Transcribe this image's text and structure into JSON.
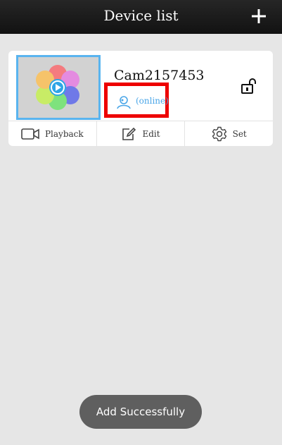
{
  "header": {
    "title": "Device list",
    "add_icon": "plus-icon"
  },
  "device": {
    "name": "Cam2157453",
    "status": "(online)",
    "status_icon": "user-icon",
    "lock_icon": "unlock-icon",
    "thumbnail_icon": "photo-flower-play-icon"
  },
  "actions": [
    {
      "label": "Playback",
      "icon": "video-camera-icon"
    },
    {
      "label": "Edit",
      "icon": "edit-icon"
    },
    {
      "label": "Set",
      "icon": "gear-icon"
    }
  ],
  "toast": {
    "message": "Add Successfully"
  },
  "colors": {
    "header_bg": "#1b1b1b",
    "accent_blue": "#4aa6e8",
    "highlight_red": "#ee0000",
    "page_bg": "#e6e6e6",
    "toast_bg": "#5f5f5f"
  }
}
